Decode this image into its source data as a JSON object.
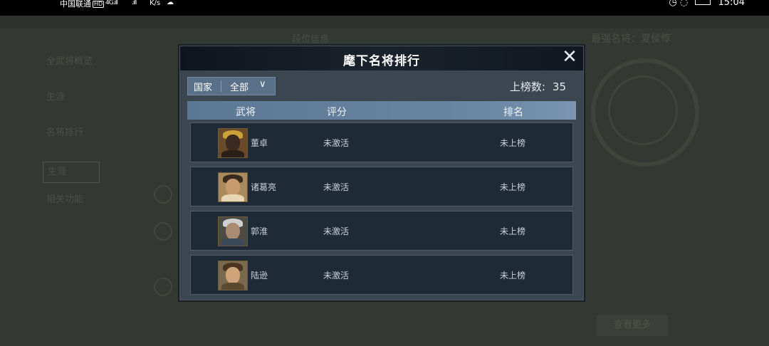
{
  "status_bar": {
    "carrier": "中国联通",
    "hd": "HD",
    "signal1": "4G.ıll",
    "signal2": ".ıll",
    "speed": "K/s",
    "time": "15:04"
  },
  "background": {
    "best_label": "最强名将：夏侯惇",
    "info_label": "段位信息",
    "nav_items": [
      "全武将概览",
      "生涯",
      "名将排行",
      "生涯",
      "相关功能"
    ],
    "more_button": "查看更多"
  },
  "dialog": {
    "title": "麾下名将排行",
    "filter": {
      "label": "国家",
      "value": "全部"
    },
    "count": {
      "label": "上榜数:",
      "value": "35"
    },
    "columns": {
      "general": "武将",
      "score": "评分",
      "rank": "排名"
    },
    "rows": [
      {
        "name": "董卓",
        "score": "未激活",
        "rank": "未上榜"
      },
      {
        "name": "诸葛亮",
        "score": "未激活",
        "rank": "未上榜"
      },
      {
        "name": "郭淮",
        "score": "未激活",
        "rank": "未上榜"
      },
      {
        "name": "陆逊",
        "score": "未激活",
        "rank": "未上榜"
      }
    ]
  },
  "colors": {
    "modal_bg": "#3c4651",
    "header_bg": "#101720",
    "row_bg": "#1f2a37",
    "thead_bg": "#6a86a3",
    "filter_bg": "#5a7088"
  }
}
